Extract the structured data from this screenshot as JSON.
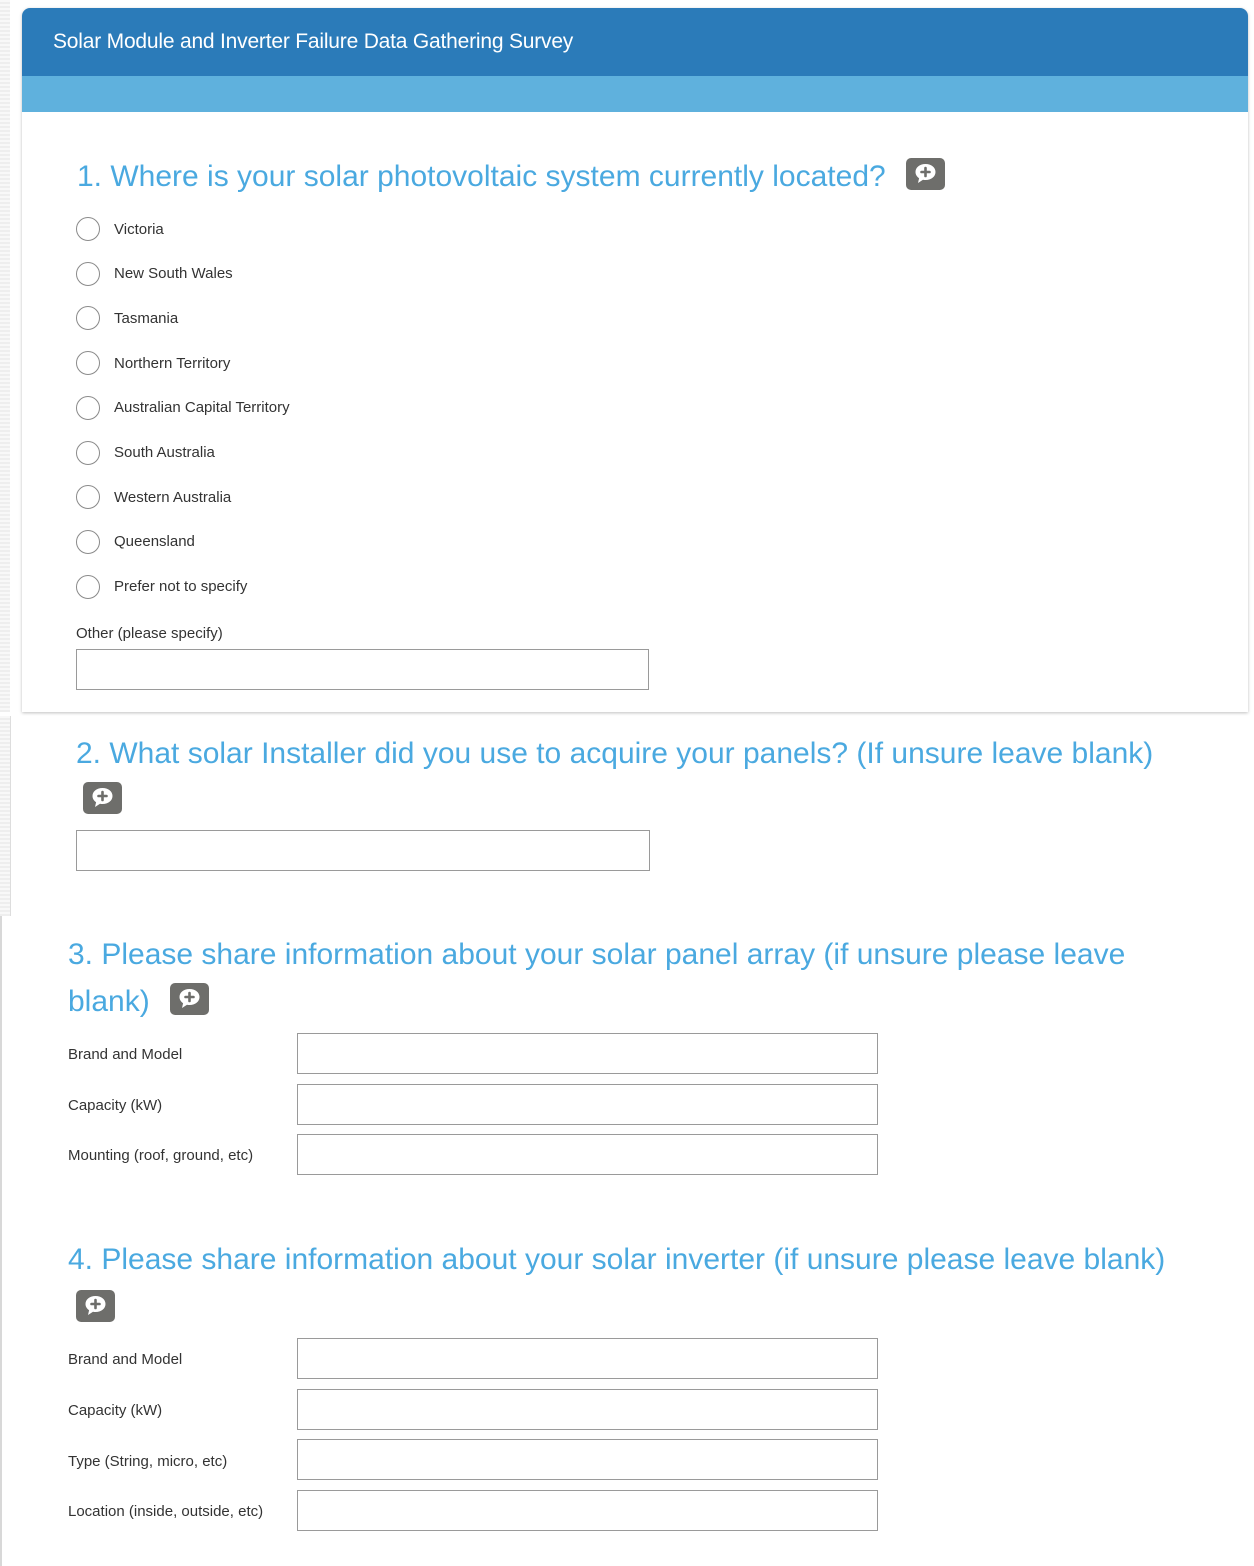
{
  "header": {
    "title": "Solar Module and Inverter Failure Data Gathering Survey",
    "brand_color": "#2b7bb9",
    "subbar_color": "#5fb1dd"
  },
  "accent_color": "#4aa9e0",
  "q1": {
    "title": "1. Where is your solar photovoltaic system currently located?",
    "comment_icon": "comment-plus-icon",
    "options": [
      "Victoria",
      "New South Wales",
      "Tasmania",
      "Northern Territory",
      "Australian Capital Territory",
      "South Australia",
      "Western Australia",
      "Queensland",
      "Prefer not to specify"
    ],
    "other_label": "Other (please specify)",
    "other_value": ""
  },
  "q2": {
    "title": "2. What solar Installer did you use to acquire your panels? (If unsure leave blank)",
    "comment_icon": "comment-plus-icon",
    "value": ""
  },
  "q3": {
    "title": "3. Please share information about your solar panel array (if unsure please leave blank)",
    "comment_icon": "comment-plus-icon",
    "fields": [
      {
        "label": "Brand and Model",
        "value": ""
      },
      {
        "label": "Capacity (kW)",
        "value": ""
      },
      {
        "label": "Mounting (roof, ground, etc)",
        "value": ""
      }
    ]
  },
  "q4": {
    "title": "4. Please share information about your solar inverter (if unsure please leave blank)",
    "comment_icon": "comment-plus-icon",
    "fields": [
      {
        "label": "Brand and Model",
        "value": ""
      },
      {
        "label": "Capacity (kW)",
        "value": ""
      },
      {
        "label": "Type (String, micro, etc)",
        "value": ""
      },
      {
        "label": "Location (inside, outside, etc)",
        "value": ""
      }
    ]
  }
}
